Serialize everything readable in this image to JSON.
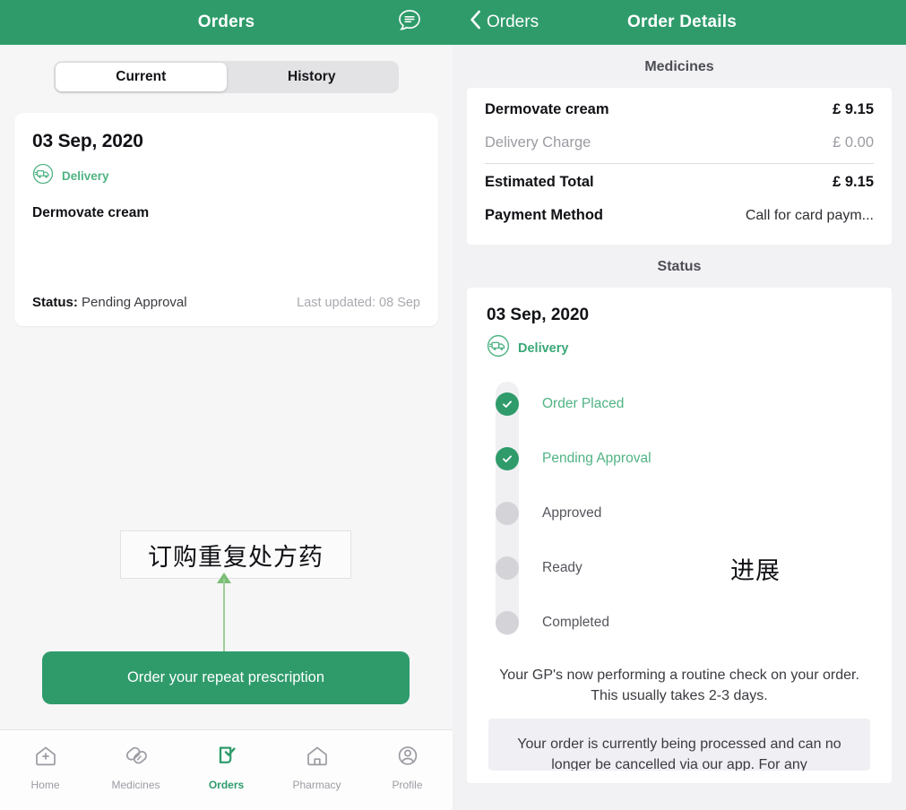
{
  "left": {
    "navbar": {
      "title": "Orders",
      "message_icon": "message-bubble-icon"
    },
    "segmented": {
      "options": [
        "Current",
        "History"
      ],
      "selected": "Current"
    },
    "order_card": {
      "date": "03 Sep, 2020",
      "delivery_icon": "delivery-truck-icon",
      "delivery_label": "Delivery",
      "medicine": "Dermovate cream",
      "status_label": "Status:",
      "status_value": "Pending Approval",
      "last_updated": "Last updated: 08 Sep"
    },
    "annotation": {
      "text": "订购重复处方药"
    },
    "cta": {
      "label": "Order your repeat prescription"
    },
    "tabbar": {
      "items": [
        {
          "label": "Home",
          "icon": "home-plus-icon",
          "active": false
        },
        {
          "label": "Medicines",
          "icon": "pills-icon",
          "active": false
        },
        {
          "label": "Orders",
          "icon": "clipboard-check-icon",
          "active": true
        },
        {
          "label": "Pharmacy",
          "icon": "pharmacy-store-icon",
          "active": false
        },
        {
          "label": "Profile",
          "icon": "person-circle-icon",
          "active": false
        }
      ]
    }
  },
  "right": {
    "navbar": {
      "back_label": "Orders",
      "back_icon": "chevron-left-icon",
      "title": "Order Details"
    },
    "medicines": {
      "section_title": "Medicines",
      "rows": [
        {
          "label": "Dermovate cream",
          "value": "£ 9.15",
          "muted": false
        },
        {
          "label": "Delivery Charge",
          "value": "£ 0.00",
          "muted": true
        }
      ],
      "total_label": "Estimated Total",
      "total_value": "£ 9.15",
      "payment_label": "Payment Method",
      "payment_value": "Call for card paym..."
    },
    "status": {
      "section_title": "Status",
      "date": "03 Sep, 2020",
      "delivery_icon": "delivery-truck-icon",
      "delivery_label": "Delivery",
      "steps": [
        {
          "label": "Order Placed",
          "done": true
        },
        {
          "label": "Pending Approval",
          "done": true
        },
        {
          "label": "Approved",
          "done": false
        },
        {
          "label": "Ready",
          "done": false
        },
        {
          "label": "Completed",
          "done": false
        }
      ],
      "annotation": "进展",
      "gp_note": "Your GP's now performing a routine check on your order. This usually takes 2-3 days.",
      "cancel_note": "Your order is currently being processed and can no longer be cancelled via our app. For any"
    }
  },
  "colors": {
    "brand_green": "#2f9b6b",
    "light_green": "#4fb383",
    "page_bg": "#f6f6f7",
    "detail_bg": "#f2f2f5",
    "muted_text": "#9b9ca2"
  }
}
